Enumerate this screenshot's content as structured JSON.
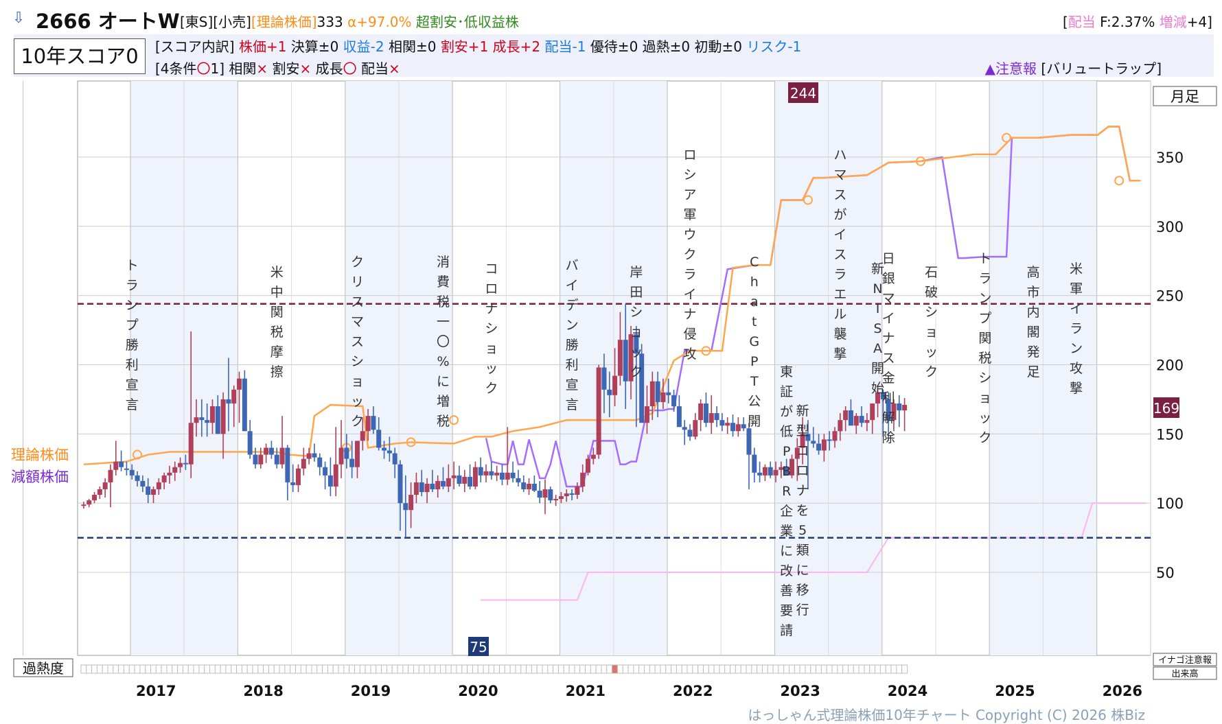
{
  "header": {
    "arrow_icon": "down-arrow-icon",
    "code_name": "2666 オートW",
    "market": "[東S][小売]",
    "theory_label": "[理論株価]",
    "theory_value": "333",
    "alpha": "α+97.0%",
    "category": "超割安･低収益株",
    "dividend_open": "[",
    "dividend_label": "配当",
    "dividend_value": " F:2.37% ",
    "change_label": "増減",
    "change_value": "+4]"
  },
  "score": {
    "title": "10年スコア0",
    "breakdown_label": "[スコア内訳]",
    "items": [
      {
        "text": "株価+1",
        "color": "#d0021b"
      },
      {
        "text": "決算±0",
        "color": "#111111"
      },
      {
        "text": "収益-2",
        "color": "#1f7ae0"
      },
      {
        "text": "相関±0",
        "color": "#111111"
      },
      {
        "text": "割安+1",
        "color": "#d0021b"
      },
      {
        "text": "成長+2",
        "color": "#d0021b"
      },
      {
        "text": "配当-1",
        "color": "#1f7ae0"
      },
      {
        "text": "優待±0",
        "color": "#111111"
      },
      {
        "text": "過熱±0",
        "color": "#111111"
      },
      {
        "text": "初動±0",
        "color": "#111111"
      },
      {
        "text": "リスク-1",
        "color": "#1f7ae0"
      }
    ],
    "conditions_label": "[4条件",
    "conditions_mark": "〇",
    "conditions_count": "1]",
    "conditions": [
      {
        "name": "相関",
        "mark": "×"
      },
      {
        "name": "割安",
        "mark": "×"
      },
      {
        "name": "成長",
        "mark": "〇"
      },
      {
        "name": "配当",
        "mark": "×"
      }
    ],
    "warning": "▲注意報",
    "warning_tag": "[バリュートラップ]"
  },
  "chart_data": {
    "type": "candlestick",
    "period": "月足",
    "years": [
      "2017",
      "2018",
      "2019",
      "2020",
      "2021",
      "2022",
      "2023",
      "2024",
      "2025",
      "2026"
    ],
    "y_ticks": [
      50,
      100,
      150,
      200,
      250,
      300,
      350
    ],
    "ylim": [
      -10,
      405
    ],
    "high_marker": 244,
    "low_marker": 75,
    "last_price": 169,
    "left_labels": {
      "theory": "理論株価",
      "reduced": "減額株価"
    },
    "overheat_label": "過熱度",
    "right_small_labels": [
      "イナゴ注意報",
      "出来高"
    ],
    "colors": {
      "up": "#b0405a",
      "down": "#3d67b4",
      "theory": "#ffa64d",
      "reduced": "#a66bff",
      "dividend": "#ffb3f0",
      "high_line": "#7a2040",
      "low_line": "#1f3a78"
    },
    "candles_ohlc": [
      [
        98,
        101,
        96,
        99
      ],
      [
        99,
        103,
        97,
        102
      ],
      [
        102,
        108,
        100,
        106
      ],
      [
        106,
        112,
        103,
        110
      ],
      [
        110,
        118,
        104,
        115
      ],
      [
        115,
        128,
        97,
        124
      ],
      [
        124,
        145,
        120,
        130
      ],
      [
        130,
        138,
        123,
        126
      ],
      [
        125,
        130,
        120,
        124
      ],
      [
        124,
        128,
        117,
        120
      ],
      [
        120,
        123,
        112,
        116
      ],
      [
        116,
        120,
        108,
        112
      ],
      [
        112,
        118,
        100,
        106
      ],
      [
        106,
        112,
        100,
        110
      ],
      [
        110,
        118,
        106,
        115
      ],
      [
        115,
        122,
        110,
        120
      ],
      [
        120,
        127,
        114,
        122
      ],
      [
        122,
        130,
        116,
        126
      ],
      [
        126,
        133,
        122,
        129
      ],
      [
        129,
        135,
        124,
        128
      ],
      [
        128,
        224,
        118,
        158
      ],
      [
        158,
        175,
        148,
        162
      ],
      [
        162,
        175,
        148,
        160
      ],
      [
        160,
        172,
        148,
        158
      ],
      [
        158,
        175,
        150,
        170
      ],
      [
        170,
        178,
        150,
        150
      ],
      [
        150,
        180,
        132,
        175
      ],
      [
        175,
        205,
        152,
        172
      ],
      [
        172,
        185,
        155,
        182
      ],
      [
        182,
        195,
        158,
        190
      ],
      [
        190,
        196,
        152,
        152
      ],
      [
        152,
        160,
        132,
        135
      ],
      [
        135,
        140,
        125,
        128
      ],
      [
        128,
        140,
        125,
        135
      ],
      [
        135,
        143,
        129,
        140
      ],
      [
        140,
        145,
        132,
        135
      ],
      [
        135,
        140,
        125,
        128
      ],
      [
        128,
        163,
        125,
        140
      ],
      [
        140,
        142,
        102,
        115
      ],
      [
        115,
        128,
        108,
        113
      ],
      [
        113,
        128,
        108,
        125
      ],
      [
        125,
        140,
        120,
        132
      ],
      [
        132,
        140,
        128,
        136
      ],
      [
        136,
        143,
        130,
        133
      ],
      [
        133,
        136,
        120,
        126
      ],
      [
        126,
        130,
        110,
        120
      ],
      [
        120,
        133,
        105,
        112
      ],
      [
        112,
        155,
        105,
        128
      ],
      [
        128,
        160,
        118,
        140
      ],
      [
        140,
        150,
        125,
        132
      ],
      [
        132,
        145,
        118,
        126
      ],
      [
        126,
        145,
        118,
        145
      ],
      [
        145,
        162,
        138,
        152
      ],
      [
        152,
        168,
        145,
        163
      ],
      [
        163,
        170,
        150,
        153
      ],
      [
        153,
        162,
        138,
        140
      ],
      [
        140,
        145,
        132,
        138
      ],
      [
        138,
        148,
        130,
        136
      ],
      [
        136,
        140,
        118,
        128
      ],
      [
        128,
        131,
        80,
        100
      ],
      [
        100,
        120,
        75,
        95
      ],
      [
        95,
        115,
        82,
        106
      ],
      [
        106,
        122,
        100,
        115
      ],
      [
        115,
        124,
        105,
        108
      ],
      [
        108,
        118,
        100,
        114
      ],
      [
        114,
        124,
        108,
        110
      ],
      [
        110,
        120,
        104,
        116
      ],
      [
        116,
        126,
        110,
        112
      ],
      [
        112,
        128,
        108,
        118
      ],
      [
        118,
        130,
        110,
        120
      ],
      [
        120,
        127,
        112,
        114
      ],
      [
        114,
        124,
        108,
        119
      ],
      [
        119,
        128,
        110,
        112
      ],
      [
        112,
        130,
        110,
        126
      ],
      [
        126,
        133,
        115,
        120
      ],
      [
        120,
        128,
        115,
        123
      ],
      [
        123,
        130,
        117,
        120
      ],
      [
        120,
        127,
        116,
        122
      ],
      [
        122,
        128,
        113,
        117
      ],
      [
        117,
        155,
        113,
        122
      ],
      [
        122,
        130,
        115,
        118
      ],
      [
        118,
        124,
        112,
        115
      ],
      [
        115,
        120,
        108,
        110
      ],
      [
        110,
        118,
        106,
        114
      ],
      [
        114,
        120,
        108,
        109
      ],
      [
        109,
        116,
        100,
        104
      ],
      [
        104,
        117,
        92,
        110
      ],
      [
        110,
        112,
        100,
        102
      ],
      [
        102,
        106,
        98,
        103
      ],
      [
        103,
        108,
        100,
        105
      ],
      [
        105,
        110,
        101,
        107
      ],
      [
        107,
        110,
        102,
        106
      ],
      [
        106,
        115,
        103,
        112
      ],
      [
        112,
        128,
        108,
        122
      ],
      [
        122,
        135,
        120,
        132
      ],
      [
        132,
        140,
        128,
        135
      ],
      [
        135,
        200,
        132,
        198
      ],
      [
        198,
        208,
        165,
        182
      ],
      [
        182,
        195,
        162,
        178
      ],
      [
        178,
        212,
        170,
        192
      ],
      [
        192,
        238,
        185,
        218
      ],
      [
        218,
        244,
        168,
        188
      ],
      [
        188,
        228,
        175,
        222
      ],
      [
        222,
        228,
        155,
        208
      ],
      [
        208,
        215,
        162,
        158
      ],
      [
        158,
        185,
        150,
        170
      ],
      [
        170,
        195,
        160,
        188
      ],
      [
        188,
        195,
        162,
        173
      ],
      [
        173,
        190,
        168,
        180
      ],
      [
        180,
        190,
        172,
        178
      ],
      [
        178,
        182,
        166,
        170
      ],
      [
        170,
        178,
        155,
        155
      ],
      [
        155,
        160,
        142,
        153
      ],
      [
        153,
        157,
        145,
        148
      ],
      [
        148,
        165,
        146,
        160
      ],
      [
        160,
        175,
        152,
        172
      ],
      [
        172,
        180,
        155,
        158
      ],
      [
        158,
        178,
        150,
        165
      ],
      [
        165,
        170,
        155,
        160
      ],
      [
        160,
        165,
        152,
        156
      ],
      [
        156,
        162,
        150,
        158
      ],
      [
        158,
        164,
        148,
        152
      ],
      [
        152,
        162,
        148,
        157
      ],
      [
        157,
        162,
        152,
        154
      ],
      [
        154,
        158,
        110,
        135
      ],
      [
        135,
        140,
        115,
        122
      ],
      [
        122,
        130,
        115,
        120
      ],
      [
        120,
        128,
        116,
        126
      ],
      [
        126,
        130,
        118,
        120
      ],
      [
        120,
        130,
        115,
        124
      ],
      [
        124,
        130,
        118,
        126
      ],
      [
        126,
        132,
        120,
        120
      ],
      [
        120,
        135,
        118,
        132
      ],
      [
        132,
        147,
        116,
        140
      ],
      [
        140,
        162,
        128,
        150
      ],
      [
        150,
        160,
        110,
        145
      ],
      [
        145,
        155,
        140,
        143
      ],
      [
        143,
        150,
        135,
        138
      ],
      [
        138,
        150,
        130,
        146
      ],
      [
        146,
        152,
        138,
        145
      ],
      [
        145,
        155,
        140,
        152
      ],
      [
        152,
        165,
        145,
        160
      ],
      [
        160,
        170,
        152,
        167
      ],
      [
        167,
        175,
        160,
        156
      ],
      [
        156,
        165,
        150,
        163
      ],
      [
        163,
        170,
        155,
        158
      ],
      [
        158,
        165,
        152,
        160
      ],
      [
        160,
        168,
        150,
        172
      ],
      [
        172,
        185,
        162,
        180
      ],
      [
        180,
        182,
        148,
        175
      ],
      [
        175,
        180,
        145,
        160
      ],
      [
        160,
        175,
        152,
        172
      ],
      [
        172,
        178,
        155,
        167
      ],
      [
        167,
        176,
        152,
        171
      ]
    ],
    "theory_price": [
      [
        0,
        128
      ],
      [
        8,
        130
      ],
      [
        12,
        135
      ],
      [
        16,
        137
      ],
      [
        20,
        137
      ],
      [
        28,
        137
      ],
      [
        32,
        137
      ],
      [
        36,
        137
      ],
      [
        38,
        135
      ],
      [
        42,
        134
      ],
      [
        43,
        163
      ],
      [
        46,
        171
      ],
      [
        52,
        170
      ],
      [
        53,
        140
      ],
      [
        58,
        143
      ],
      [
        61,
        144
      ],
      [
        69,
        143
      ],
      [
        73,
        148
      ],
      [
        76,
        148
      ],
      [
        80,
        152
      ],
      [
        85,
        155
      ],
      [
        90,
        160
      ],
      [
        103,
        160
      ],
      [
        106,
        165
      ],
      [
        110,
        203
      ],
      [
        113,
        210
      ],
      [
        116,
        210
      ],
      [
        119,
        210
      ],
      [
        121,
        270
      ],
      [
        125,
        272
      ],
      [
        128,
        272
      ],
      [
        130,
        319
      ],
      [
        134,
        319
      ],
      [
        136,
        335
      ],
      [
        138,
        335
      ],
      [
        142,
        336
      ],
      [
        146,
        337
      ],
      [
        150,
        346
      ],
      [
        156,
        347
      ],
      [
        162,
        350
      ],
      [
        166,
        352
      ],
      [
        170,
        352
      ],
      [
        173,
        364
      ],
      [
        178,
        364
      ],
      [
        184,
        366
      ],
      [
        189,
        366
      ],
      [
        191,
        372
      ],
      [
        193,
        372
      ],
      [
        195,
        333
      ],
      [
        197,
        333
      ]
    ],
    "theory_circles": [
      [
        10,
        135
      ],
      [
        49,
        140
      ],
      [
        61,
        144
      ],
      [
        69,
        160
      ],
      [
        116,
        210
      ],
      [
        135,
        319
      ],
      [
        156,
        347
      ],
      [
        172,
        364
      ],
      [
        193,
        333
      ]
    ],
    "reduced_price": [
      [
        75,
        147
      ],
      [
        76,
        130
      ],
      [
        78,
        128
      ],
      [
        79,
        128
      ],
      [
        80,
        145
      ],
      [
        81,
        128
      ],
      [
        82,
        128
      ],
      [
        83,
        146
      ],
      [
        85,
        118
      ],
      [
        86,
        118
      ],
      [
        87,
        128
      ],
      [
        88,
        145
      ],
      [
        90,
        112
      ],
      [
        93,
        112
      ],
      [
        95,
        145
      ],
      [
        99,
        145
      ],
      [
        100,
        128
      ],
      [
        101,
        128
      ],
      [
        102,
        130
      ],
      [
        103,
        130
      ],
      [
        105,
        167
      ],
      [
        108,
        167
      ],
      [
        109,
        168
      ],
      [
        110,
        168
      ],
      [
        112,
        210
      ],
      [
        117,
        210
      ],
      [
        120,
        269
      ],
      [
        125,
        272
      ],
      [
        128,
        272
      ],
      [
        130,
        319
      ],
      [
        134,
        319
      ],
      [
        136,
        335
      ],
      [
        138,
        335
      ],
      [
        142,
        336
      ],
      [
        146,
        337
      ],
      [
        150,
        346
      ],
      [
        156,
        347
      ],
      [
        160,
        350
      ],
      [
        163,
        277
      ],
      [
        164,
        277
      ],
      [
        168,
        278
      ],
      [
        172,
        278
      ],
      [
        173,
        364
      ],
      [
        178,
        364
      ],
      [
        184,
        366
      ],
      [
        189,
        366
      ],
      [
        191,
        372
      ],
      [
        193,
        372
      ],
      [
        195,
        333
      ],
      [
        197,
        333
      ]
    ],
    "dividend_line": [
      [
        74,
        30
      ],
      [
        92,
        30
      ],
      [
        94,
        50
      ],
      [
        118,
        50
      ],
      [
        134,
        50
      ],
      [
        146,
        50
      ],
      [
        150,
        75
      ],
      [
        162,
        75
      ],
      [
        178,
        75
      ],
      [
        186,
        75
      ],
      [
        188,
        100
      ],
      [
        198,
        100
      ]
    ],
    "events": [
      {
        "x": 9,
        "text": "トランプ勝利宣言"
      },
      {
        "x": 36,
        "text": "米中関税摩擦"
      },
      {
        "x": 51,
        "text": "クリスマスショック"
      },
      {
        "x": 67,
        "text": "消費税一〇%に増税"
      },
      {
        "x": 76,
        "text": "コロナショック"
      },
      {
        "x": 91,
        "text": "バイデン勝利宣言"
      },
      {
        "x": 103,
        "text": "岸田ショック"
      },
      {
        "x": 113,
        "text": "ロシア軍ウクライナ侵攻"
      },
      {
        "x": 125,
        "text": "ChatGPT公開"
      },
      {
        "x": 131,
        "text": "東証が低PBR企業に改善要請"
      },
      {
        "x": 134,
        "text": "新型コロナを5類に移行"
      },
      {
        "x": 141,
        "text": "ハマスがイスラエル襲撃"
      },
      {
        "x": 148,
        "text": "新NISA開始"
      },
      {
        "x": 150,
        "text": "日銀マイナス金利解除"
      },
      {
        "x": 158,
        "text": "石破ショック"
      },
      {
        "x": 168,
        "text": "トランプ関税ショック"
      },
      {
        "x": 177,
        "text": "高市内閣発足"
      },
      {
        "x": 185,
        "text": "米軍イラン攻撃"
      }
    ]
  },
  "footer": "はっしゃん式理論株価10年チャート Copyright (C) 2026 株Biz"
}
